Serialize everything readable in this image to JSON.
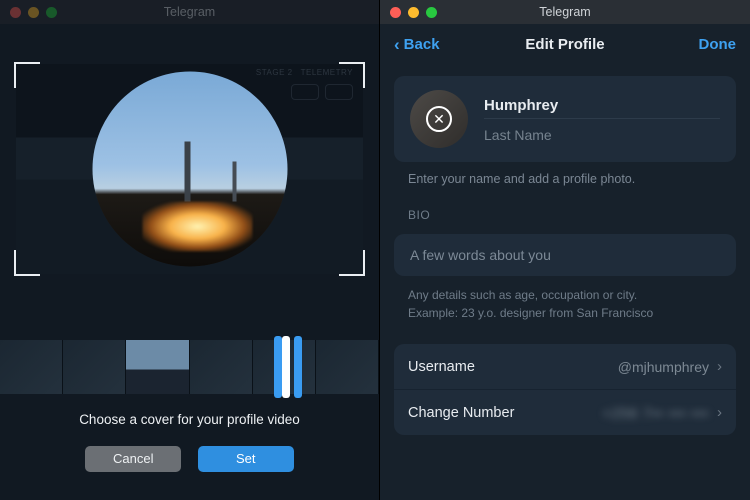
{
  "left": {
    "app_title": "Telegram",
    "prompt": "Choose a cover for your profile video",
    "cancel_label": "Cancel",
    "set_label": "Set"
  },
  "right": {
    "app_title": "Telegram",
    "back_label": "Back",
    "page_title": "Edit Profile",
    "done_label": "Done",
    "first_name": "Humphrey",
    "last_name_placeholder": "Last Name",
    "name_hint": "Enter your name and add a profile photo.",
    "bio_label": "BIO",
    "bio_placeholder": "A few words about you",
    "bio_hint_line1": "Any details such as age, occupation or city.",
    "bio_hint_line2": "Example: 23 y.o. designer from San Francisco",
    "username_label": "Username",
    "username_value": "@mjhumphrey",
    "change_number_label": "Change Number",
    "change_number_value": "+256 7•• ••• •••"
  }
}
